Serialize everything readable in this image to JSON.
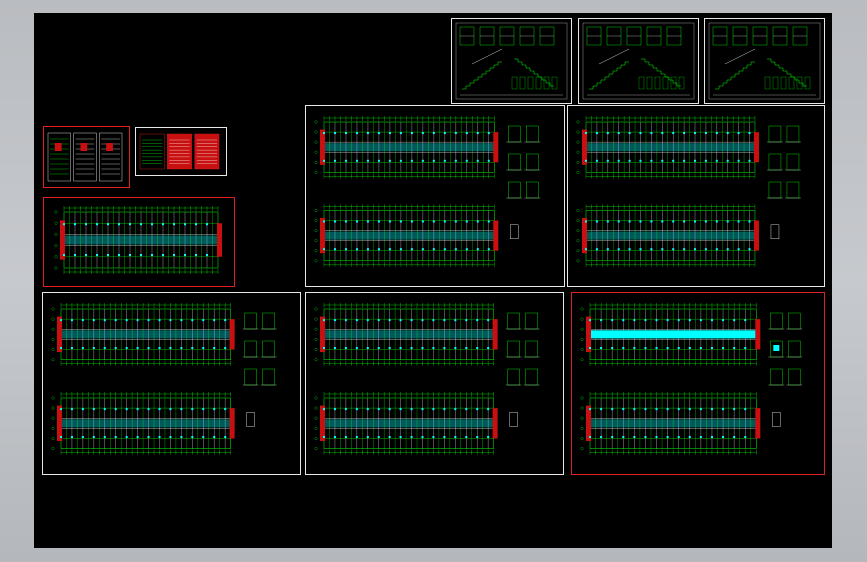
{
  "app": {
    "title": ""
  },
  "viewport": {
    "background": "#000000",
    "frame_color": "#c3c6ca",
    "colors": {
      "sheet_border": "#e8e8e8",
      "sheet_border_highlight": "#e02020",
      "grid": "#00ff00",
      "axis": "#ffffff",
      "fill_cyan": "#00ffff",
      "fill_red": "#c81010",
      "dim": "#ffff00"
    }
  },
  "sheets": [
    {
      "id": "stair-detail-1",
      "kind": "details",
      "title": ""
    },
    {
      "id": "stair-detail-2",
      "kind": "details",
      "title": ""
    },
    {
      "id": "stair-detail-3",
      "kind": "details",
      "title": ""
    },
    {
      "id": "general-notes-1",
      "kind": "notes",
      "title": ""
    },
    {
      "id": "general-notes-2",
      "kind": "notes-red",
      "title": ""
    },
    {
      "id": "foundation-plan",
      "kind": "plan-single",
      "title": ""
    },
    {
      "id": "floor-plan-a",
      "kind": "plan-double",
      "title": ""
    },
    {
      "id": "floor-plan-b",
      "kind": "plan-double",
      "title": ""
    },
    {
      "id": "floor-plan-c",
      "kind": "plan-double",
      "title": ""
    },
    {
      "id": "floor-plan-d",
      "kind": "plan-double",
      "title": ""
    },
    {
      "id": "floor-plan-e",
      "kind": "plan-double-cyan",
      "title": ""
    }
  ]
}
